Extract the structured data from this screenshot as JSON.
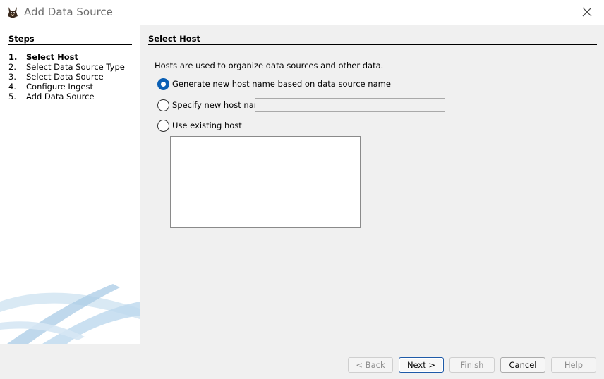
{
  "window": {
    "title": "Add Data Source"
  },
  "steps": {
    "heading": "Steps",
    "items": [
      {
        "num": "1.",
        "label": "Select Host"
      },
      {
        "num": "2.",
        "label": "Select Data Source Type"
      },
      {
        "num": "3.",
        "label": "Select Data Source"
      },
      {
        "num": "4.",
        "label": "Configure Ingest"
      },
      {
        "num": "5.",
        "label": "Add Data Source"
      }
    ],
    "active_index": 0
  },
  "panel": {
    "heading": "Select Host",
    "description": "Hosts are used to organize data sources and other data.",
    "options": {
      "generate": {
        "label": "Generate new host name based on data source name",
        "checked": true
      },
      "specify": {
        "label": "Specify new host name",
        "checked": false
      },
      "existing": {
        "label": "Use existing host",
        "checked": false
      }
    },
    "host_name_value": ""
  },
  "buttons": {
    "back": "< Back",
    "next": "Next >",
    "finish": "Finish",
    "cancel": "Cancel",
    "help": "Help"
  },
  "colors": {
    "accent": "#0a5fb4",
    "swoosh": "#7fb3d8"
  },
  "icons": {
    "app": "autopsy-dog-icon",
    "close": "close-icon"
  }
}
